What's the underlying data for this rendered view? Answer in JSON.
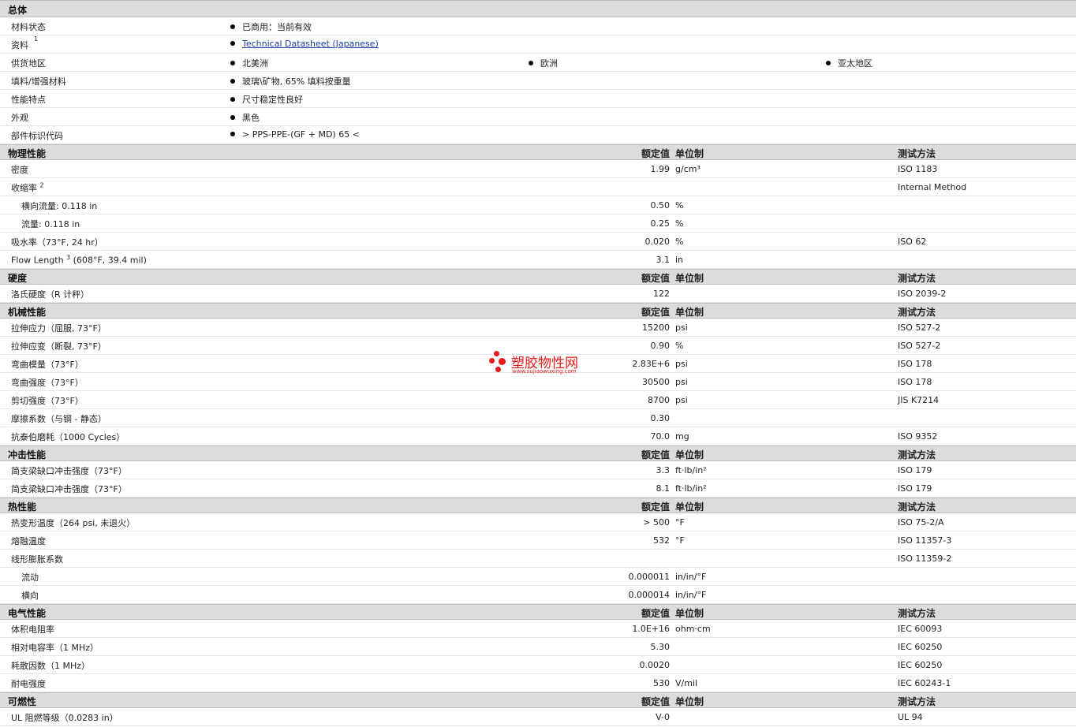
{
  "general": {
    "title": "总体",
    "rows": [
      {
        "label": "材料状态",
        "items": [
          "已商用：当前有效"
        ]
      },
      {
        "label": "资料",
        "sup": "1",
        "items": [
          "Technical Datasheet (Japanese)"
        ],
        "link": true
      },
      {
        "label": "供货地区",
        "items": [
          "北美洲",
          "欧洲",
          "亚太地区"
        ]
      },
      {
        "label": "填料/增强材料",
        "items": [
          "玻璃\\矿物, 65% 填料按重量"
        ]
      },
      {
        "label": "性能特点",
        "items": [
          "尺寸稳定性良好"
        ]
      },
      {
        "label": "外观",
        "items": [
          "黑色"
        ]
      },
      {
        "label": "部件标识代码",
        "items": [
          "> PPS-PPE-(GF + MD) 65 <"
        ]
      }
    ]
  },
  "columns": {
    "value": "额定值",
    "unit": "单位制",
    "method": "测试方法"
  },
  "sections": [
    {
      "title": "物理性能",
      "rows": [
        {
          "label": "密度",
          "value": "1.99",
          "unit": "g/cm³",
          "method": "ISO 1183"
        },
        {
          "label": "收缩率",
          "sup": "2",
          "value": "",
          "unit": "",
          "method": "Internal Method"
        },
        {
          "label": "横向流量: 0.118 in",
          "sub": true,
          "value": "0.50",
          "unit": "%",
          "method": ""
        },
        {
          "label": "流量: 0.118 in",
          "sub": true,
          "value": "0.25",
          "unit": "%",
          "method": ""
        },
        {
          "label": "吸水率（73°F, 24 hr）",
          "value": "0.020",
          "unit": "%",
          "method": "ISO 62"
        },
        {
          "label": "Flow Length",
          "sup": "3",
          "suffix": " (608°F, 39.4 mil)",
          "value": "3.1",
          "unit": "in",
          "method": ""
        }
      ]
    },
    {
      "title": "硬度",
      "rows": [
        {
          "label": "洛氏硬度（R 计秤）",
          "value": "122",
          "unit": "",
          "method": "ISO 2039-2"
        }
      ]
    },
    {
      "title": "机械性能",
      "rows": [
        {
          "label": "拉伸应力（屈服, 73°F）",
          "value": "15200",
          "unit": "psi",
          "method": "ISO 527-2"
        },
        {
          "label": "拉伸应变（断裂, 73°F）",
          "value": "0.90",
          "unit": "%",
          "method": "ISO 527-2"
        },
        {
          "label": "弯曲模量（73°F）",
          "value": "2.83E+6",
          "unit": "psi",
          "method": "ISO 178"
        },
        {
          "label": "弯曲强度（73°F）",
          "value": "30500",
          "unit": "psi",
          "method": "ISO 178"
        },
        {
          "label": "剪切强度（73°F）",
          "value": "8700",
          "unit": "psi",
          "method": "JIS K7214"
        },
        {
          "label": "摩擦系数（与钢 - 静态）",
          "value": "0.30",
          "unit": "",
          "method": ""
        },
        {
          "label": "抗泰伯磨耗（1000 Cycles）",
          "value": "70.0",
          "unit": "mg",
          "method": "ISO 9352"
        }
      ]
    },
    {
      "title": "冲击性能",
      "rows": [
        {
          "label": "简支梁缺口冲击强度（73°F）",
          "value": "3.3",
          "unit": "ft·lb/in²",
          "method": "ISO 179"
        },
        {
          "label": "简支梁缺口冲击强度（73°F）",
          "value": "8.1",
          "unit": "ft·lb/in²",
          "method": "ISO 179"
        }
      ]
    },
    {
      "title": "热性能",
      "rows": [
        {
          "label": "热变形温度（264 psi, 未退火）",
          "value": "> 500",
          "unit": "°F",
          "method": "ISO 75-2/A"
        },
        {
          "label": "熔融温度",
          "value": "532",
          "unit": "°F",
          "method": "ISO 11357-3"
        },
        {
          "label": "线形膨胀系数",
          "value": "",
          "unit": "",
          "method": "ISO 11359-2"
        },
        {
          "label": "流动",
          "sub": true,
          "value": "0.000011",
          "unit": "in/in/°F",
          "method": ""
        },
        {
          "label": "横向",
          "sub": true,
          "value": "0.000014",
          "unit": "in/in/°F",
          "method": ""
        }
      ]
    },
    {
      "title": "电气性能",
      "rows": [
        {
          "label": "体积电阻率",
          "value": "1.0E+16",
          "unit": "ohm·cm",
          "method": "IEC 60093"
        },
        {
          "label": "相对电容率（1 MHz）",
          "value": "5.30",
          "unit": "",
          "method": "IEC 60250"
        },
        {
          "label": "耗散因数（1 MHz）",
          "value": "0.0020",
          "unit": "",
          "method": "IEC 60250"
        },
        {
          "label": "耐电强度",
          "value": "530",
          "unit": "V/mil",
          "method": "IEC 60243-1"
        }
      ]
    },
    {
      "title": "可燃性",
      "rows": [
        {
          "label": "UL 阻燃等级（0.0283 in）",
          "value": "V-0",
          "unit": "",
          "method": "UL 94"
        }
      ]
    }
  ],
  "watermark": {
    "name": "塑胶物性网",
    "url": "www.sujiaowuxing.com"
  }
}
